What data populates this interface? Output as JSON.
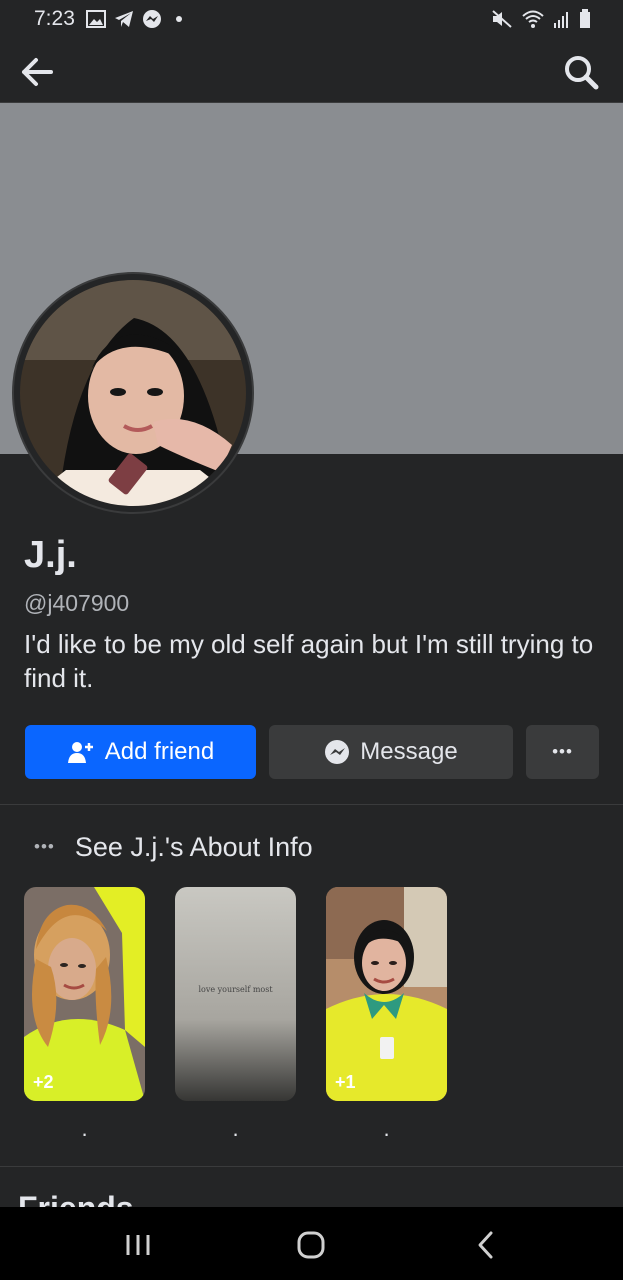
{
  "status_bar": {
    "time": "7:23",
    "left_icons": [
      "gallery-icon",
      "telegram-icon",
      "messenger-icon",
      "dot-icon"
    ],
    "right_icons": [
      "mute-icon",
      "wifi-icon",
      "signal-icon",
      "battery-icon"
    ]
  },
  "app_bar": {
    "back_icon": "arrow-left-icon",
    "search_icon": "search-icon"
  },
  "profile": {
    "name": "J.j.",
    "username": "@j407900",
    "bio": "I'd like to be my old self again but I'm still trying to find it."
  },
  "actions": {
    "add_friend": "Add friend",
    "message": "Message",
    "more": "•••"
  },
  "about": {
    "dots": "•••",
    "label": "See J.j.'s About Info"
  },
  "stories": [
    {
      "badge": "+2",
      "caption": "."
    },
    {
      "image_text": "love yourself most",
      "caption": "."
    },
    {
      "badge": "+1",
      "caption": "."
    }
  ],
  "sections": {
    "friends_title": "Friends"
  },
  "colors": {
    "background": "#242526",
    "cover": "#8a8d91",
    "primary_button": "#0a66ff",
    "secondary_button": "#3a3b3c",
    "text": "#e4e6eb",
    "muted_text": "#b0b3b8"
  }
}
